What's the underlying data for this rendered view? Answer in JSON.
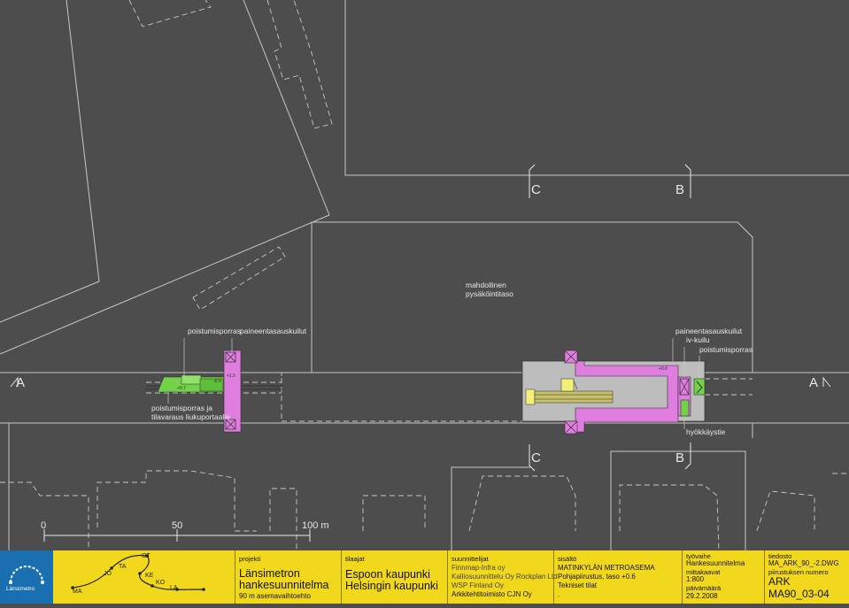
{
  "colors": {
    "background": "#4d4d4d",
    "lines": "#c8c8c8",
    "station_magenta": "#e07ee0",
    "station_green": "#73d24a",
    "station_grey": "#bdbdbd",
    "titleblock_yellow": "#f2d81c",
    "logo_blue": "#1a6fb0"
  },
  "plan_labels": {
    "parking_1": "mahdollinen",
    "parking_2": "pysäköintitaso",
    "exit_left": "poistumisporras",
    "pressure_shaft_left": "paineentasauskuilut",
    "exit_escalator_1": "poistumisporras ja",
    "exit_escalator_2": "tilavaraus liukuportaalle",
    "pressure_shaft_right": "paineentasauskuilut",
    "iv_shaft": "iv-kuilu",
    "exit_right": "poistumisporras",
    "attack_route": "hyökkäystie",
    "level_west_1": "+1.5",
    "level_west_2": "-6.9",
    "level_west_3": "+0.7",
    "level_east": "+0.6"
  },
  "section_marks": {
    "a_left": "A",
    "a_right": "A",
    "c_top": "C",
    "b_top": "B",
    "c_bottom": "C",
    "b_bottom": "B"
  },
  "scale_bar": {
    "start": "0",
    "mid": "50",
    "end": "100 m"
  },
  "logo": {
    "brand": "Länsimetro"
  },
  "route_map": {
    "stations": [
      "MA",
      "JO",
      "TA",
      "OT",
      "KE",
      "KO",
      "LA"
    ]
  },
  "titleblock": {
    "projekti_label": "projekti",
    "projekti_1": "Länsimetron",
    "projekti_2": "hankesuunnitelma",
    "projekti_3": "90 m asemavaihtoehto",
    "tilaajat_label": "tilaajat",
    "tilaajat_1": "Espoon kaupunki",
    "tilaajat_2": "Helsingin kaupunki",
    "suunnittelijat_label": "suunnittelijat",
    "suunnittelijat_1": "Finnmap-Infra oy",
    "suunnittelijat_2": "Kalliosuunnittelu Oy Rockplan Ltd",
    "suunnittelijat_3": "WSP Finland Oy",
    "suunnittelijat_4": "Arkkitehtitoimisto CJN Oy",
    "sisalto_label": "sisältö",
    "sisalto_1": "MATINKYLÄN METROASEMA",
    "sisalto_2": "Pohjapiirustus, taso +0.6",
    "sisalto_3": "Tekniset tilat",
    "sisalto_4": ".",
    "tyovaihe_label": "työvaihe",
    "tyovaihe": "Hankesuunnitelma",
    "mittakaava_label": "mittakaavat",
    "mittakaava": "1:800",
    "paivamaara_label": "päivämäärä",
    "paivamaara": "29.2.2008",
    "tiedosto_label": "tiedosto",
    "tiedosto": "MA_ARK_90_-2.DWG",
    "piirustus_label": "piirustuksen numero",
    "piirustus_1": "ARK",
    "piirustus_2": "MA90_03-04"
  }
}
